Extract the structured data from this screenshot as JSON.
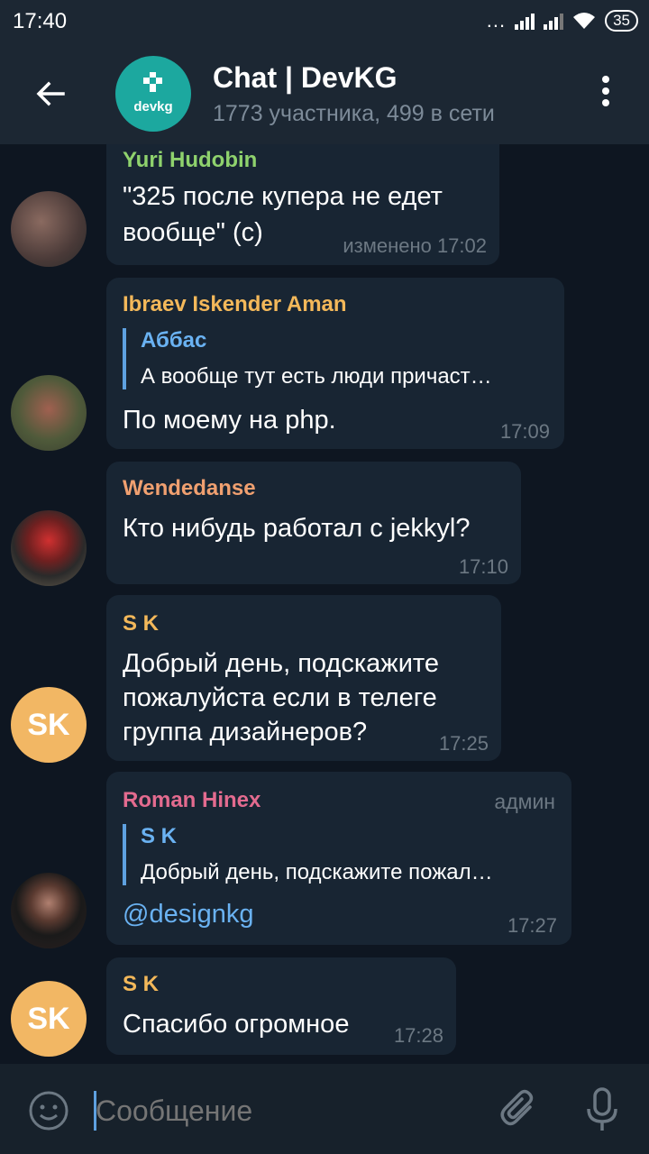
{
  "status_bar": {
    "time": "17:40",
    "dots": "...",
    "battery": "35"
  },
  "header": {
    "title": "Chat | DevKG",
    "subtitle": "1773 участника, 499 в сети",
    "avatar_text": "devkg"
  },
  "messages": [
    {
      "sender": "Yuri Hudobin",
      "sender_color": "#8fd26d",
      "text_lines": [
        "\"325 после купера не едет",
        "вообще\" (с)"
      ],
      "time": "изменено 17:02"
    },
    {
      "sender": "Ibraev Iskender Aman",
      "sender_color": "#f3b85a",
      "reply_name": "Аббас",
      "reply_text": "А вообще тут есть люди причаст…",
      "text": "По моему на php.",
      "time": "17:09"
    },
    {
      "sender": "Wendedanse",
      "sender_color": "#f0a070",
      "text": "Кто нибудь работал с jekkyl?",
      "time": "17:10"
    },
    {
      "sender": "S K",
      "sender_color": "#f3b85a",
      "avatar_initials": "SK",
      "text_lines": [
        "Добрый день, подскажите",
        "пожалуйста если в телеге",
        "группа дизайнеров?"
      ],
      "time": "17:25"
    },
    {
      "sender": "Roman Hinex",
      "sender_color": "#e36b8f",
      "badge": "админ",
      "reply_name": "S K",
      "reply_text": "Добрый день, подскажите пожал…",
      "text": "@designkg",
      "time": "17:27"
    },
    {
      "sender": "S K",
      "sender_color": "#f3b85a",
      "avatar_initials": "SK",
      "text": "Спасибо огромное",
      "time": "17:28"
    }
  ],
  "input": {
    "placeholder": "Сообщение"
  },
  "colors": {
    "background": "#0e1621",
    "bubble": "#182533",
    "header": "#1c2733",
    "accent": "#5ea1e0"
  },
  "icons": [
    "back-arrow-icon",
    "more-vertical-icon",
    "emoji-icon",
    "attach-paperclip-icon",
    "microphone-icon"
  ]
}
